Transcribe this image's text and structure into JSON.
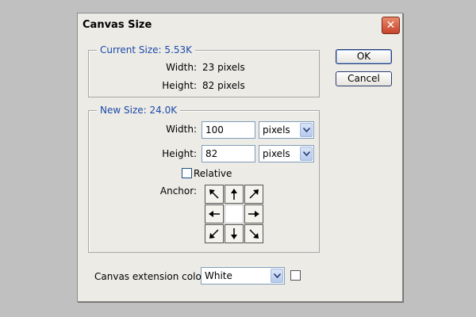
{
  "dialog": {
    "title": "Canvas Size",
    "close_glyph": "✕"
  },
  "current_size": {
    "legend": "Current Size: 5.53K",
    "width_label": "Width:",
    "width_value": "23 pixels",
    "height_label": "Height:",
    "height_value": "82 pixels"
  },
  "new_size": {
    "legend": "New Size: 24.0K",
    "width_label": "Width:",
    "width_value": "100",
    "width_unit": "pixels",
    "height_label": "Height:",
    "height_value": "82",
    "height_unit": "pixels",
    "relative_label": "Relative",
    "relative_checked": false,
    "anchor_label": "Anchor:",
    "anchor_selected": "center",
    "anchor_icons": [
      "arrow-up-left-icon",
      "arrow-up-icon",
      "arrow-up-right-icon",
      "arrow-left-icon",
      "anchor-center",
      "arrow-right-icon",
      "arrow-down-left-icon",
      "arrow-down-icon",
      "arrow-down-right-icon"
    ]
  },
  "extension": {
    "label": "Canvas extension color:",
    "value": "White",
    "swatch_color": "#ffffff"
  },
  "buttons": {
    "ok": "OK",
    "cancel": "Cancel"
  },
  "colors": {
    "accent": "#1d4aa8",
    "close": "#c6432a"
  }
}
